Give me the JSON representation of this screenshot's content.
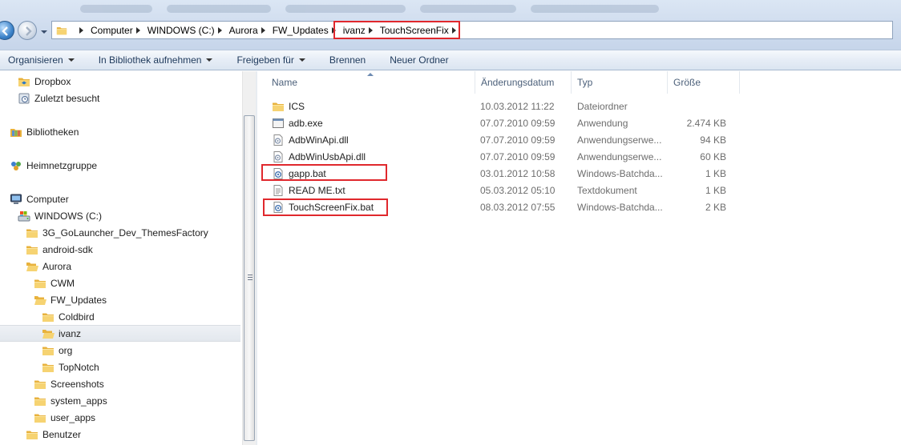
{
  "breadcrumbs": [
    "Computer",
    "WINDOWS (C:)",
    "Aurora",
    "FW_Updates",
    "ivanz",
    "TouchScreenFix"
  ],
  "toolbar": {
    "organize": "Organisieren",
    "library": "In Bibliothek aufnehmen",
    "share": "Freigeben für",
    "burn": "Brennen",
    "new_folder": "Neuer Ordner"
  },
  "nav": {
    "dropbox": "Dropbox",
    "recent": "Zuletzt besucht",
    "libraries": "Bibliotheken",
    "homegroup": "Heimnetzgruppe",
    "computer": "Computer",
    "drive": "WINDOWS (C:)",
    "f_golauncher": "3G_GoLauncher_Dev_ThemesFactory",
    "f_android": "android-sdk",
    "f_aurora": "Aurora",
    "f_cwm": "CWM",
    "f_fwupdates": "FW_Updates",
    "f_coldbird": "Coldbird",
    "f_ivanz": "ivanz",
    "f_org": "org",
    "f_topnotch": "TopNotch",
    "f_screenshots": "Screenshots",
    "f_sysapps": "system_apps",
    "f_userapps": "user_apps",
    "f_benutzer": "Benutzer"
  },
  "columns": {
    "name": "Name",
    "date": "Änderungsdatum",
    "type": "Typ",
    "size": "Größe"
  },
  "files": [
    {
      "name": "ICS",
      "date": "10.03.2012 11:22",
      "type": "Dateiordner",
      "size": "",
      "icon": "folder-icon"
    },
    {
      "name": "adb.exe",
      "date": "07.07.2010 09:59",
      "type": "Anwendung",
      "size": "2.474 KB",
      "icon": "exe-icon"
    },
    {
      "name": "AdbWinApi.dll",
      "date": "07.07.2010 09:59",
      "type": "Anwendungserwe...",
      "size": "94 KB",
      "icon": "dll-icon"
    },
    {
      "name": "AdbWinUsbApi.dll",
      "date": "07.07.2010 09:59",
      "type": "Anwendungserwe...",
      "size": "60 KB",
      "icon": "dll-icon"
    },
    {
      "name": "gapp.bat",
      "date": "03.01.2012 10:58",
      "type": "Windows-Batchda...",
      "size": "1 KB",
      "icon": "batch-file-icon"
    },
    {
      "name": "READ ME.txt",
      "date": "05.03.2012 05:10",
      "type": "Textdokument",
      "size": "1 KB",
      "icon": "text-file-icon"
    },
    {
      "name": "TouchScreenFix.bat",
      "date": "08.03.2012 07:55",
      "type": "Windows-Batchda...",
      "size": "2 KB",
      "icon": "batch-file-icon"
    }
  ],
  "colors": {
    "highlight_box": "#e0282d",
    "toolbar_text": "#1e395b",
    "header_text": "#4c607a",
    "folder_yellow": "#f2c65a"
  }
}
